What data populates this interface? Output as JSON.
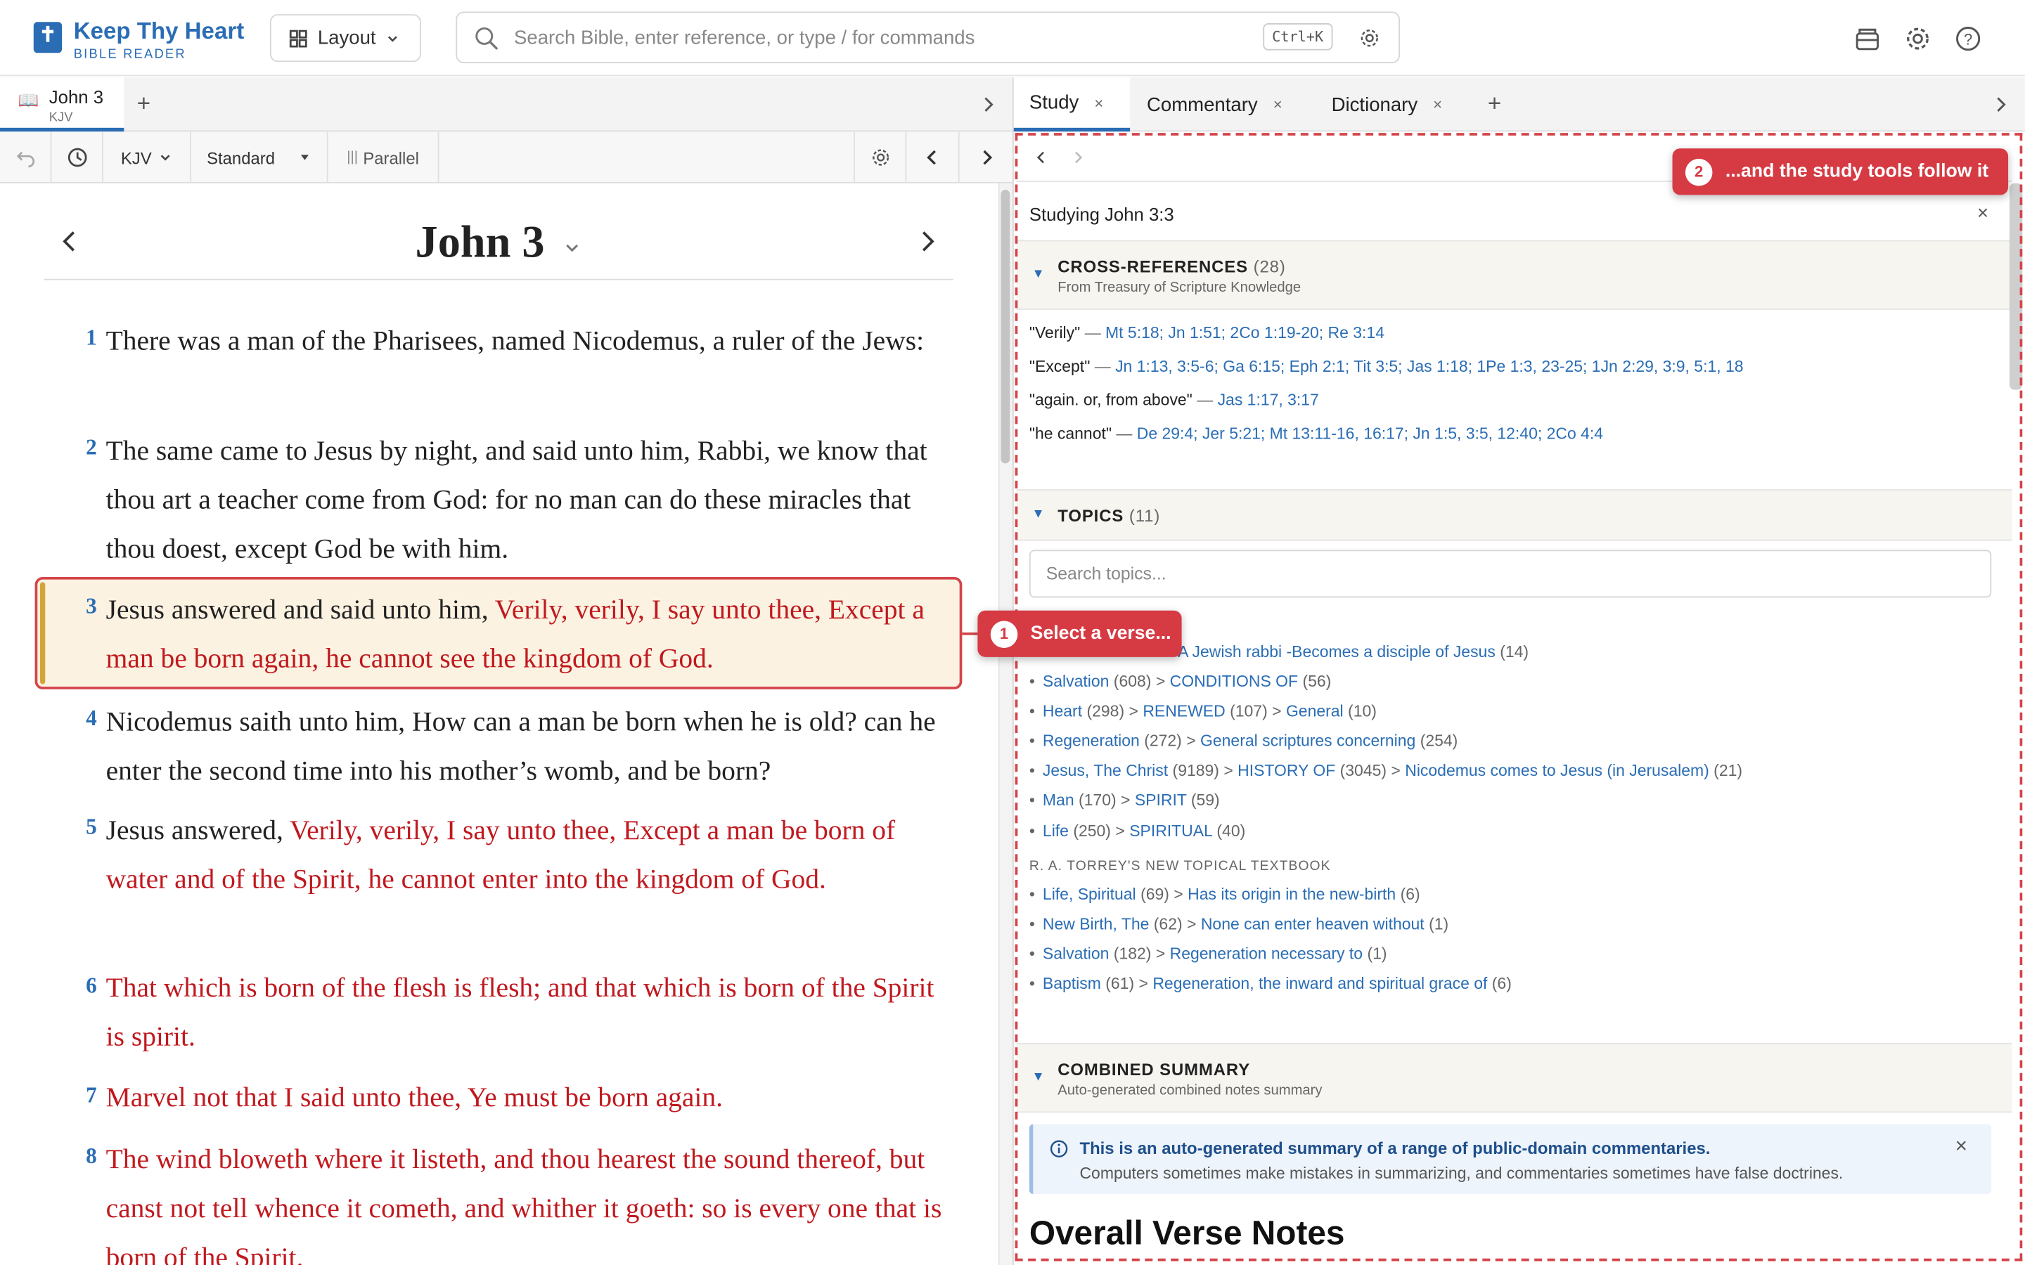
{
  "app": {
    "title": "Keep Thy Heart",
    "subtitle": "BIBLE READER",
    "layout_label": "Layout"
  },
  "search": {
    "placeholder": "Search Bible, enter reference, or type / for commands",
    "shortcut": "Ctrl+K"
  },
  "left_tab": {
    "name": "John 3",
    "version": "KJV",
    "add": "+"
  },
  "toolbar": {
    "version": "KJV",
    "mode": "Standard",
    "parallel": "Parallel"
  },
  "chapter": {
    "title": "John 3"
  },
  "verses": [
    {
      "num": "1",
      "plain": "There was a man of the Pharisees, named Nicodemus, a ruler of the Jews:",
      "red": ""
    },
    {
      "num": "2",
      "plain": "The same came to Jesus by night, and said unto him, Rabbi, we know that thou art a teacher come from God: for no man can do these miracles that thou doest, except God be with him.",
      "red": ""
    },
    {
      "num": "3",
      "plain": "Jesus answered and said unto him, ",
      "red": "Verily, verily, I say unto thee, Except a man be born again, he cannot see the kingdom of God."
    },
    {
      "num": "4",
      "plain": "Nicodemus saith unto him, How can a man be born when he is old? can he enter the second time into his mother’s womb, and be born?",
      "red": ""
    },
    {
      "num": "5",
      "plain": "Jesus answered, ",
      "red": "Verily, verily, I say unto thee, Except a man be born of water and of the Spirit, he cannot enter into the kingdom of God."
    },
    {
      "num": "6",
      "plain": "",
      "red": "That which is born of the flesh is flesh; and that which is born of the Spirit is spirit."
    },
    {
      "num": "7",
      "plain": "",
      "red": "Marvel not that I said unto thee, Ye must be born again."
    },
    {
      "num": "8",
      "plain": "",
      "red": "The wind bloweth where it listeth, and thou hearest the sound thereof, but canst not tell whence it cometh, and whither it goeth: so is every one that is born of the Spirit."
    }
  ],
  "right_tabs": [
    {
      "label": "Study",
      "close": "×"
    },
    {
      "label": "Commentary",
      "close": "×"
    },
    {
      "label": "Dictionary",
      "close": "×"
    }
  ],
  "right_tab_add": "+",
  "study": {
    "heading": "Studying John 3:3",
    "close": "×",
    "xref_section": {
      "title": "CROSS-REFERENCES",
      "count": "(28)",
      "subtitle": "From Treasury of Scripture Knowledge"
    },
    "xrefs": [
      {
        "phrase": "\"Verily\"",
        "dash": " — ",
        "refs": "Mt 5:18; Jn 1:51; 2Co 1:19-20; Re 3:14"
      },
      {
        "phrase": "\"Except\"",
        "dash": " — ",
        "refs": "Jn 1:13, 3:5-6; Ga 6:15; Eph 2:1; Tit 3:5; Jas 1:18; 1Pe 1:3, 23-25; 1Jn 2:29, 3:9, 5:1, 18"
      },
      {
        "phrase": "\"again. or, from above\"",
        "dash": " — ",
        "refs": "Jas 1:17, 3:17"
      },
      {
        "phrase": "\"he cannot\"",
        "dash": " — ",
        "refs": "De 29:4; Jer 5:21; Mt 13:11-16, 16:17; Jn 1:5, 3:5, 12:40; 2Co 4:4"
      }
    ],
    "topics_section": {
      "title": "TOPICS",
      "count": "(11)",
      "search_placeholder": "Search topics..."
    },
    "topics_partial": {
      "tail": "A Jewish rabbi -Becomes a disciple of Jesus",
      "tail_count": "(14)"
    },
    "topics": [
      {
        "a": "Salvation",
        "ac": "(608)",
        "b": "CONDITIONS OF",
        "bc": "(56)",
        "c": "",
        "cc": ""
      },
      {
        "a": "Heart",
        "ac": "(298)",
        "b": "RENEWED",
        "bc": "(107)",
        "c": "General",
        "cc": "(10)"
      },
      {
        "a": "Regeneration",
        "ac": "(272)",
        "b": "General scriptures concerning",
        "bc": "(254)",
        "c": "",
        "cc": ""
      },
      {
        "a": "Jesus, The Christ",
        "ac": "(9189)",
        "b": "HISTORY OF",
        "bc": "(3045)",
        "c": "Nicodemus comes to Jesus (in Jerusalem)",
        "cc": "(21)"
      },
      {
        "a": "Man",
        "ac": "(170)",
        "b": "SPIRIT",
        "bc": "(59)",
        "c": "",
        "cc": ""
      },
      {
        "a": "Life",
        "ac": "(250)",
        "b": "SPIRITUAL",
        "bc": "(40)",
        "c": "",
        "cc": ""
      }
    ],
    "torrey_label": "R. A. TORREY'S NEW TOPICAL TEXTBOOK",
    "torrey_topics": [
      {
        "a": "Life, Spiritual",
        "ac": "(69)",
        "b": "Has its origin in the new-birth",
        "bc": "(6)"
      },
      {
        "a": "New Birth, The",
        "ac": "(62)",
        "b": "None can enter heaven without",
        "bc": "(1)"
      },
      {
        "a": "Salvation",
        "ac": "(182)",
        "b": "Regeneration necessary to",
        "bc": "(1)"
      },
      {
        "a": "Baptism",
        "ac": "(61)",
        "b": "Regeneration, the inward and spiritual grace of",
        "bc": "(6)"
      }
    ],
    "summary_section": {
      "title": "COMBINED SUMMARY",
      "subtitle": "Auto-generated combined notes summary"
    },
    "info": {
      "title": "This is an auto-generated summary of a range of public-domain commentaries.",
      "text": "Computers sometimes make mistakes in summarizing, and commentaries sometimes have false doctrines.",
      "close": "×"
    },
    "overall_heading": "Overall Verse Notes"
  },
  "callouts": [
    {
      "num": "1",
      "text": "Select a verse..."
    },
    {
      "num": "2",
      "text": "...and the study tools follow it"
    }
  ],
  "colors": {
    "accent": "#2a6db5",
    "words_of_christ": "#c0191f",
    "callout": "#d63a43",
    "highlight": "#fbf2e1"
  }
}
